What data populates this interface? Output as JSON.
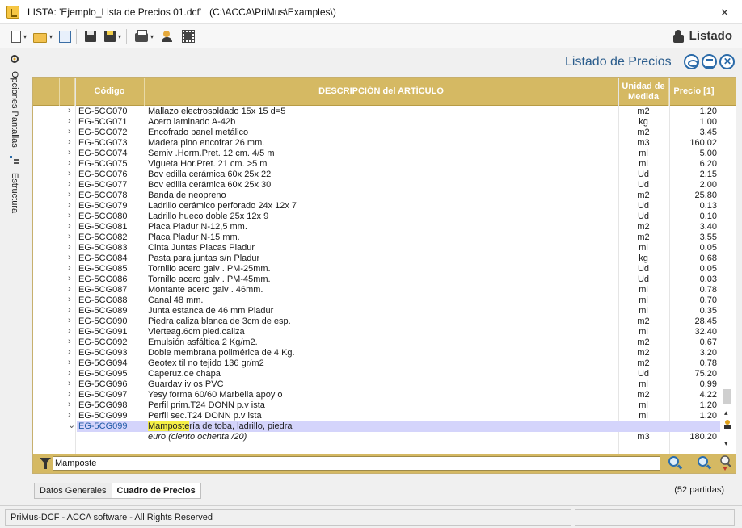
{
  "window": {
    "title": "LISTA: 'Ejemplo_Lista de Precios 01.dcf'   (C:\\ACCA\\PriMus\\Examples\\)",
    "close_glyph": "✕"
  },
  "toolbar": {
    "caret": "▾",
    "right_title": "Listado"
  },
  "side_tabs": {
    "options_label": "Opciones Pantallas",
    "structure_label": "Estructura"
  },
  "heading": "Listado de Precios",
  "columns": {
    "code": "Código",
    "description": "DESCRIPCIÓN del ARTÍCULO",
    "unit": "Unidad de Medida",
    "price": "Precio [1]"
  },
  "rows": [
    {
      "code": "EG-5CG070",
      "desc": "Mallazo electrosoldado 15x 15 d=5",
      "unit": "m2",
      "price": "1.20"
    },
    {
      "code": "EG-5CG071",
      "desc": "Acero laminado A-42b",
      "unit": "kg",
      "price": "1.00"
    },
    {
      "code": "EG-5CG072",
      "desc": "Encofrado panel metálico",
      "unit": "m2",
      "price": "3.45"
    },
    {
      "code": "EG-5CG073",
      "desc": "Madera pino encofrar 26 mm.",
      "unit": "m3",
      "price": "160.02"
    },
    {
      "code": "EG-5CG074",
      "desc": "Semiv .Horm.Pret. 12 cm. 4/5 m",
      "unit": "ml",
      "price": "5.00"
    },
    {
      "code": "EG-5CG075",
      "desc": "Vigueta Hor.Pret. 21 cm. >5 m",
      "unit": "ml",
      "price": "6.20"
    },
    {
      "code": "EG-5CG076",
      "desc": "Bov edilla cerámica 60x 25x 22",
      "unit": "Ud",
      "price": "2.15"
    },
    {
      "code": "EG-5CG077",
      "desc": "Bov edilla cerámica 60x 25x 30",
      "unit": "Ud",
      "price": "2.00"
    },
    {
      "code": "EG-5CG078",
      "desc": "Banda de neopreno",
      "unit": "m2",
      "price": "25.80"
    },
    {
      "code": "EG-5CG079",
      "desc": "Ladrillo cerámico perforado 24x 12x 7",
      "unit": "Ud",
      "price": "0.13"
    },
    {
      "code": "EG-5CG080",
      "desc": "Ladrillo hueco doble 25x 12x 9",
      "unit": "Ud",
      "price": "0.10"
    },
    {
      "code": "EG-5CG081",
      "desc": "Placa Pladur N-12,5 mm.",
      "unit": "m2",
      "price": "3.40"
    },
    {
      "code": "EG-5CG082",
      "desc": "Placa Pladur N-15 mm.",
      "unit": "m2",
      "price": "3.55"
    },
    {
      "code": "EG-5CG083",
      "desc": "Cinta Juntas Placas Pladur",
      "unit": "ml",
      "price": "0.05"
    },
    {
      "code": "EG-5CG084",
      "desc": "Pasta para juntas s/n Pladur",
      "unit": "kg",
      "price": "0.68"
    },
    {
      "code": "EG-5CG085",
      "desc": "Tornillo acero galv . PM-25mm.",
      "unit": "Ud",
      "price": "0.05"
    },
    {
      "code": "EG-5CG086",
      "desc": "Tornillo acero galv . PM-45mm.",
      "unit": "Ud",
      "price": "0.03"
    },
    {
      "code": "EG-5CG087",
      "desc": "Montante acero galv . 46mm.",
      "unit": "ml",
      "price": "0.78"
    },
    {
      "code": "EG-5CG088",
      "desc": "Canal 48 mm.",
      "unit": "ml",
      "price": "0.70"
    },
    {
      "code": "EG-5CG089",
      "desc": "Junta estanca de 46 mm Pladur",
      "unit": "ml",
      "price": "0.35"
    },
    {
      "code": "EG-5CG090",
      "desc": "Piedra caliza blanca de 3cm de esp.",
      "unit": "m2",
      "price": "28.45"
    },
    {
      "code": "EG-5CG091",
      "desc": "Vierteag.6cm pied.caliza",
      "unit": "ml",
      "price": "32.40"
    },
    {
      "code": "EG-5CG092",
      "desc": "Emulsión asfáltica 2 Kg/m2.",
      "unit": "m2",
      "price": "0.67"
    },
    {
      "code": "EG-5CG093",
      "desc": "Doble membrana polimérica de 4 Kg.",
      "unit": "m2",
      "price": "3.20"
    },
    {
      "code": "EG-5CG094",
      "desc": "Geotex til no tejido 136 gr/m2",
      "unit": "m2",
      "price": "0.78"
    },
    {
      "code": "EG-5CG095",
      "desc": "Caperuz.de chapa",
      "unit": "Ud",
      "price": "75.20"
    },
    {
      "code": "EG-5CG096",
      "desc": "Guardav iv os PVC",
      "unit": "ml",
      "price": "0.99"
    },
    {
      "code": "EG-5CG097",
      "desc": "Yesy forma 60/60 Marbella apoy o",
      "unit": "m2",
      "price": "4.22"
    },
    {
      "code": "EG-5CG098",
      "desc": "Perfil prim.T24 DONN p.v ista",
      "unit": "ml",
      "price": "1.20"
    },
    {
      "code": "EG-5CG099",
      "desc": "Perfil sec.T24 DONN p.v ista",
      "unit": "ml",
      "price": "1.20"
    }
  ],
  "selected": {
    "code": "EG-5CG099",
    "desc_highlight": "Mamposte",
    "desc_rest": "ría de toba, ladrillo, piedra",
    "subdesc": "euro (ciento ochenta /20)",
    "unit": "m3",
    "price": "180.20"
  },
  "chevrons": {
    "collapsed": "›",
    "expanded": "⌄"
  },
  "scroll": {
    "up": "▴",
    "down": "▾"
  },
  "filter": {
    "value": "Mamposte"
  },
  "bottom_tabs": [
    {
      "label": "Datos Generales"
    },
    {
      "label": "Cuadro de Precios"
    }
  ],
  "partidas": "(52 partidas)",
  "status": {
    "text": "PriMus-DCF - ACCA software - All Rights Reserved"
  }
}
